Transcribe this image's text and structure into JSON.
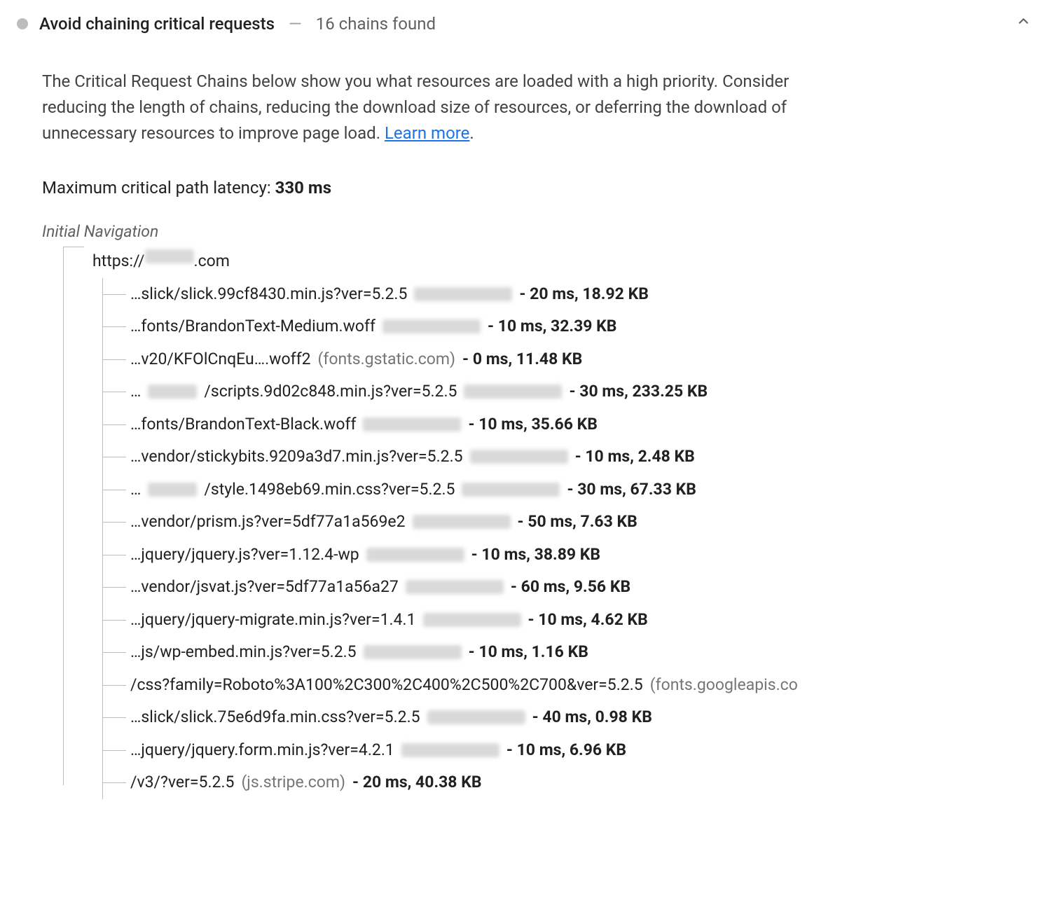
{
  "audit": {
    "title": "Avoid chaining critical requests",
    "dash": "—",
    "count_text": "16 chains found",
    "description_pre": "The Critical Request Chains below show you what resources are loaded with a high priority. Consider reducing the length of chains, reducing the download size of resources, or deferring the download of unnecessary resources to improve page load. ",
    "learn_more": "Learn more",
    "description_post": ".",
    "max_latency_label": "Maximum critical path latency: ",
    "max_latency_value": "330 ms",
    "initial_nav_label": "Initial Navigation",
    "root_url_pre": "https://",
    "root_url_post": ".com"
  },
  "chains": [
    {
      "path": "…slick/slick.99cf8430.min.js?ver=5.2.5",
      "host_blur": true,
      "stats": "- 20 ms, 18.92 KB"
    },
    {
      "path": "…fonts/BrandonText-Medium.woff",
      "host_blur": true,
      "stats": "- 10 ms, 32.39 KB"
    },
    {
      "path": "…v20/KFOlCnqEu….woff2",
      "host_text": "(fonts.gstatic.com)",
      "stats": "- 0 ms, 11.48 KB"
    },
    {
      "path_pre": "…",
      "path_blur": true,
      "path_post": "/scripts.9d02c848.min.js?ver=5.2.5",
      "host_blur": true,
      "stats": "- 30 ms, 233.25 KB"
    },
    {
      "path": "…fonts/BrandonText-Black.woff",
      "host_blur": true,
      "stats": "- 10 ms, 35.66 KB"
    },
    {
      "path": "…vendor/stickybits.9209a3d7.min.js?ver=5.2.5",
      "host_blur": true,
      "stats": "- 10 ms, 2.48 KB"
    },
    {
      "path_pre": "…",
      "path_blur": true,
      "path_post": "/style.1498eb69.min.css?ver=5.2.5",
      "host_blur": true,
      "stats": "- 30 ms, 67.33 KB"
    },
    {
      "path": "…vendor/prism.js?ver=5df77a1a569e2",
      "host_blur": true,
      "stats": "- 50 ms, 7.63 KB"
    },
    {
      "path": "…jquery/jquery.js?ver=1.12.4-wp",
      "host_blur": true,
      "stats": "- 10 ms, 38.89 KB"
    },
    {
      "path": "…vendor/jsvat.js?ver=5df77a1a56a27",
      "host_blur": true,
      "stats": "- 60 ms, 9.56 KB"
    },
    {
      "path": "…jquery/jquery-migrate.min.js?ver=1.4.1",
      "host_blur": true,
      "stats": "- 10 ms, 4.62 KB"
    },
    {
      "path": "…js/wp-embed.min.js?ver=5.2.5",
      "host_blur": true,
      "stats": "- 10 ms, 1.16 KB"
    },
    {
      "path": "/css?family=Roboto%3A100%2C300%2C400%2C500%2C700&ver=5.2.5",
      "host_text": "(fonts.googleapis.co",
      "stats": ""
    },
    {
      "path": "…slick/slick.75e6d9fa.min.css?ver=5.2.5",
      "host_blur": true,
      "stats": "- 40 ms, 0.98 KB"
    },
    {
      "path": "…jquery/jquery.form.min.js?ver=4.2.1",
      "host_blur": true,
      "stats": "- 10 ms, 6.96 KB"
    },
    {
      "path": "/v3/?ver=5.2.5",
      "host_text": "(js.stripe.com)",
      "stats": "- 20 ms, 40.38 KB"
    }
  ]
}
